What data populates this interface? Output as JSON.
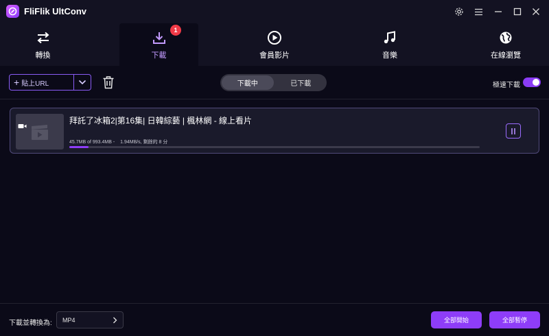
{
  "app": {
    "title": "FliFlik UltConv"
  },
  "window_controls": [
    "settings-icon",
    "menu-icon",
    "minimize-icon",
    "maximize-icon",
    "close-icon"
  ],
  "nav": {
    "tabs": [
      {
        "label": "轉換",
        "icon": "convert-arrows-icon"
      },
      {
        "label": "下載",
        "icon": "download-icon",
        "badge": "1",
        "active": true
      },
      {
        "label": "會員影片",
        "icon": "play-circle-icon"
      },
      {
        "label": "音樂",
        "icon": "music-note-icon"
      },
      {
        "label": "在線瀏覽",
        "icon": "globe-icon"
      }
    ]
  },
  "toolbar": {
    "paste_label": "貼上URL",
    "segments": [
      {
        "label": "下載中",
        "active": true
      },
      {
        "label": "已下載",
        "active": false
      }
    ],
    "turbo_label": "極速下載",
    "turbo_on": true
  },
  "downloads": [
    {
      "title": "拜託了冰箱2|第16集| 日韓綜藝 | 楓林網 - 線上看片",
      "size_text": "45.7MB of 993.4MB -",
      "speed_text": "1.94MB/s, 剩餘的 8 分",
      "progress": 0.046
    }
  ],
  "footer": {
    "convert_label": "下載並轉換為:",
    "format": "MP4",
    "start_all": "全部開始",
    "pause_all": "全部暫停"
  },
  "colors": {
    "accent": "#8e3df8",
    "badge": "#f03a47",
    "background": "#0b0a18",
    "panel": "#131222"
  }
}
